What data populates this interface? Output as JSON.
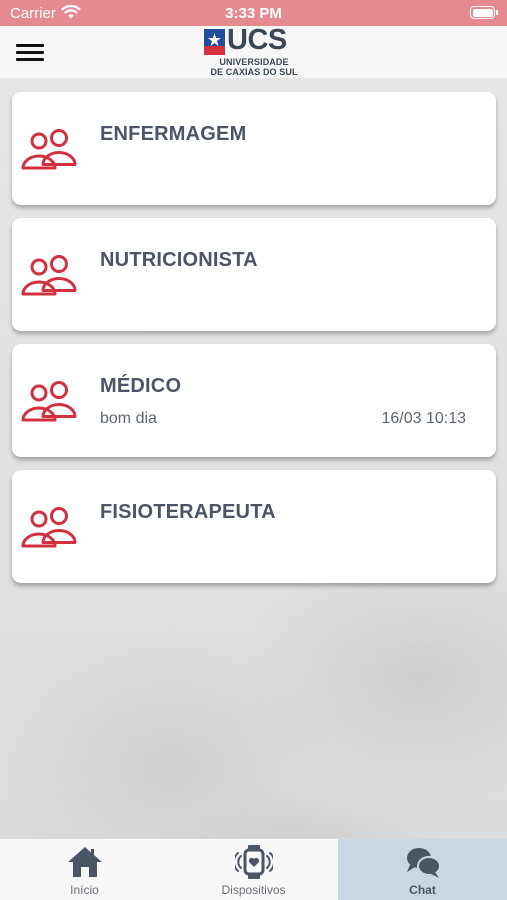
{
  "status_bar": {
    "carrier": "Carrier",
    "time": "3:33 PM",
    "color": "#e58a8f"
  },
  "header": {
    "logo_text": "UCS",
    "logo_subtitle_1": "UNIVERSIDADE",
    "logo_subtitle_2": "DE CAXIAS DO SUL",
    "menu_icon": "hamburger-menu-icon"
  },
  "chats": [
    {
      "title": "ENFERMAGEM",
      "message": "",
      "timestamp": "",
      "icon": "group-icon"
    },
    {
      "title": "NUTRICIONISTA",
      "message": "",
      "timestamp": "",
      "icon": "group-icon"
    },
    {
      "title": "MÉDICO",
      "message": "bom dia",
      "timestamp": "16/03 10:13",
      "icon": "group-icon"
    },
    {
      "title": "FISIOTERAPEUTA",
      "message": "",
      "timestamp": "",
      "icon": "group-icon"
    }
  ],
  "tab_bar": {
    "tabs": [
      {
        "label": "Início",
        "icon": "home-icon",
        "active": false
      },
      {
        "label": "Dispositivos",
        "icon": "smartwatch-icon",
        "active": false
      },
      {
        "label": "Chat",
        "icon": "chat-bubbles-icon",
        "active": true
      }
    ]
  },
  "colors": {
    "accent_red": "#d1303f",
    "title_text": "#4c5566",
    "active_tab": "#c8d7e1"
  }
}
